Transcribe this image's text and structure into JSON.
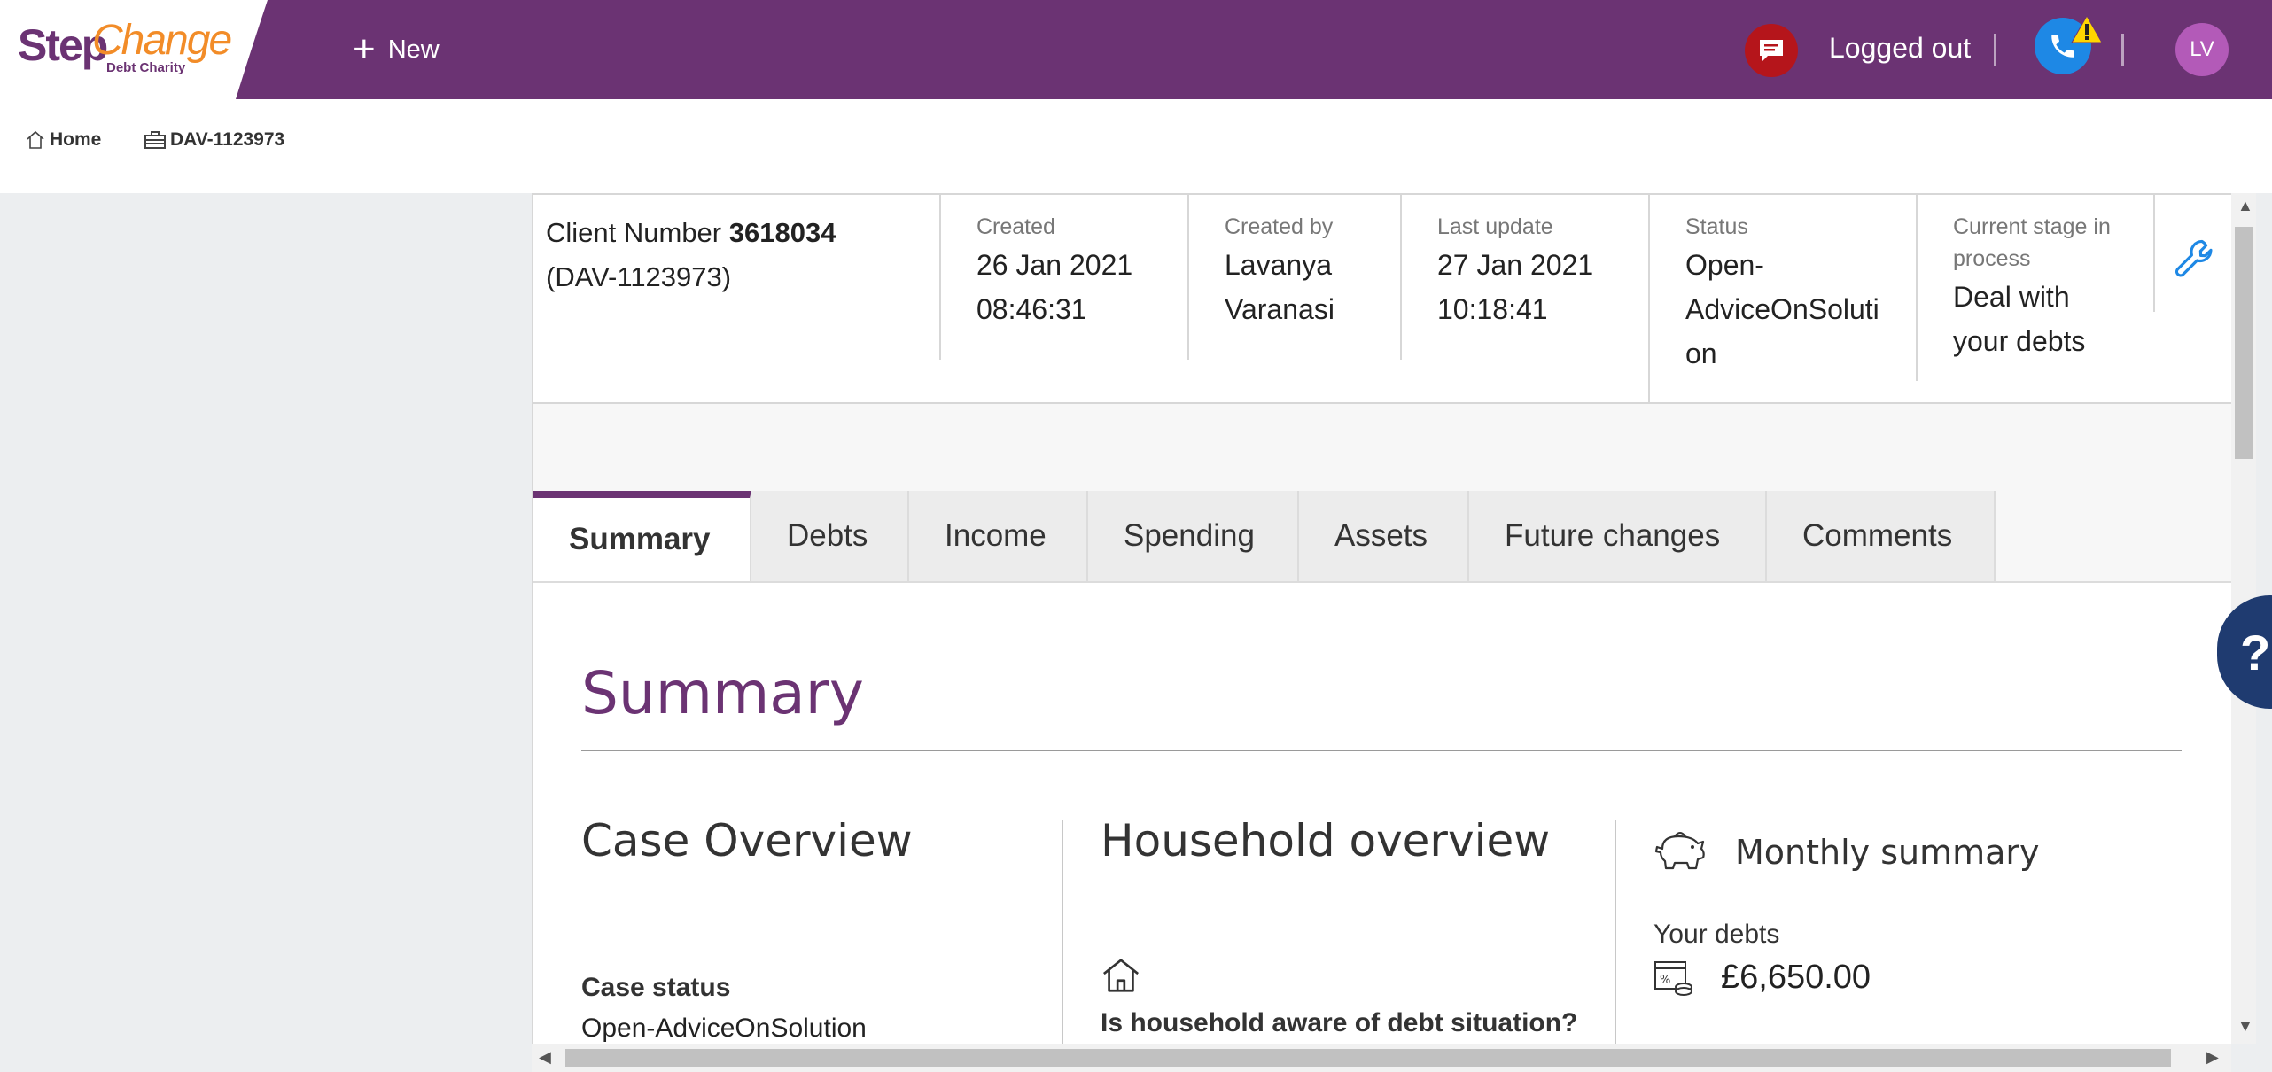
{
  "logo": {
    "step": "Step",
    "change": "Change",
    "sub": "Debt Charity"
  },
  "topbar": {
    "new_label": "New",
    "login_status": "Logged out",
    "avatar_initials": "LV"
  },
  "breadcrumb": {
    "home": "Home",
    "case": "DAV-1123973"
  },
  "case_header": {
    "client_label": "Client Number",
    "client_number": "3618034",
    "case_ref": "(DAV-1123973)",
    "created_label": "Created",
    "created_date": "26 Jan 2021",
    "created_time": "08:46:31",
    "created_by_label": "Created by",
    "created_by_first": "Lavanya",
    "created_by_last": "Varanasi",
    "last_update_label": "Last update",
    "last_update_date": "27 Jan 2021",
    "last_update_time": "10:18:41",
    "status_label": "Status",
    "status_line1": "Open-",
    "status_line2": "AdviceOnSoluti",
    "status_line3": "on",
    "stage_label_1": "Current stage in",
    "stage_label_2": "process",
    "stage_line1": "Deal with",
    "stage_line2": "your debts"
  },
  "tabs": [
    {
      "label": "Summary"
    },
    {
      "label": "Debts"
    },
    {
      "label": "Income"
    },
    {
      "label": "Spending"
    },
    {
      "label": "Assets"
    },
    {
      "label": "Future changes"
    },
    {
      "label": "Comments"
    }
  ],
  "summary": {
    "title": "Summary",
    "case_overview": "Case Overview",
    "case_status_label": "Case status",
    "case_status_value": "Open-AdviceOnSolution",
    "household_overview": "Household overview",
    "aware_question": "Is household aware of debt situation?",
    "monthly_summary": "Monthly summary",
    "your_debts_label": "Your debts",
    "your_debts_value": "£6,650.00"
  },
  "help": {
    "label": "?"
  },
  "colors": {
    "brand_purple": "#6b3373",
    "brand_orange": "#f28c28",
    "help_navy": "#1f3b70"
  }
}
